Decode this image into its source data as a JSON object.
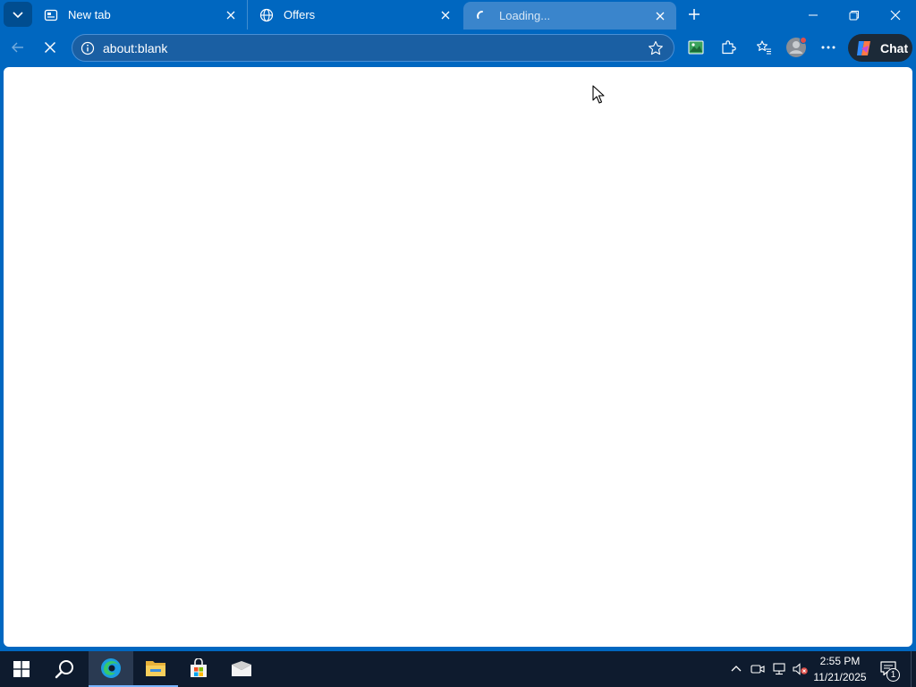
{
  "tabs": [
    {
      "title": "New tab",
      "icon": "newtab-page-icon"
    },
    {
      "title": "Offers",
      "icon": "globe-icon"
    },
    {
      "title": "Loading...",
      "icon": "loading-spinner-icon",
      "active": true
    }
  ],
  "toolbar": {
    "address": "about:blank",
    "copilot_label": "Chat"
  },
  "taskbar": {
    "time": "2:55 PM",
    "date": "11/21/2025",
    "notification_count": "1",
    "pinned": [
      "edge-icon",
      "file-explorer-icon",
      "store-icon",
      "mail-icon"
    ]
  },
  "colors": {
    "accent": "#0067c0",
    "taskbar": "#0e1b2e",
    "page_background": "#ffffff"
  }
}
